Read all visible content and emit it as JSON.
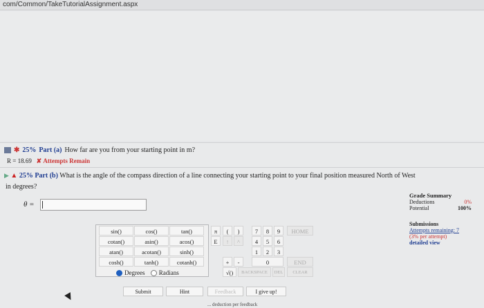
{
  "browser": {
    "url": "com/Common/TakeTutorialAssignment.aspx"
  },
  "partA": {
    "percent": "25%",
    "label": "Part (a)",
    "question": "How far are you from your starting point in m?",
    "answer": "R = 18.69",
    "attempts": "Attempts Remain"
  },
  "partB": {
    "percent": "25%",
    "label": "Part (b)",
    "question": "What is the angle of the compass direction of a line connecting your starting point to your final position measured North of West",
    "question2": "in degrees?",
    "input_label": "θ =",
    "input_value": ""
  },
  "grade": {
    "title": "Grade Summary",
    "deductions_label": "Deductions",
    "deductions_value": "0%",
    "potential_label": "Potential",
    "potential_value": "100%"
  },
  "submissions": {
    "title": "Submissions",
    "attempts_remaining": "Attempts remaining: 7",
    "per_attempt": "(3% per attempt)",
    "detailed_view": "detailed view"
  },
  "functions": [
    [
      "sin()",
      "cos()",
      "tan()"
    ],
    [
      "cotan()",
      "asin()",
      "acos()"
    ],
    [
      "atan()",
      "acotan()",
      "sinh()"
    ],
    [
      "cosh()",
      "tanh()",
      "cotanh()"
    ]
  ],
  "angle_mode": {
    "degrees": "Degrees",
    "radians": "Radians",
    "selected": "Degrees"
  },
  "keypad": {
    "pi": "π",
    "open_paren": "(",
    "close_paren": ")",
    "e": "E",
    "up": "↑",
    "up_caret": "^",
    "plus": "+",
    "minus": "-",
    "sqrt": "√()",
    "backspace": "BACKSPACE",
    "del": "DEL",
    "clear": "CLEAR",
    "home": "HOME",
    "end": "END",
    "digits": [
      "7",
      "8",
      "9",
      "4",
      "5",
      "6",
      "1",
      "2",
      "3",
      "0"
    ]
  },
  "buttons": {
    "submit": "Submit",
    "hint": "Hint",
    "feedback": "Feedback",
    "give_up": "I give up!"
  },
  "footer_text": "... deduction per feedback"
}
